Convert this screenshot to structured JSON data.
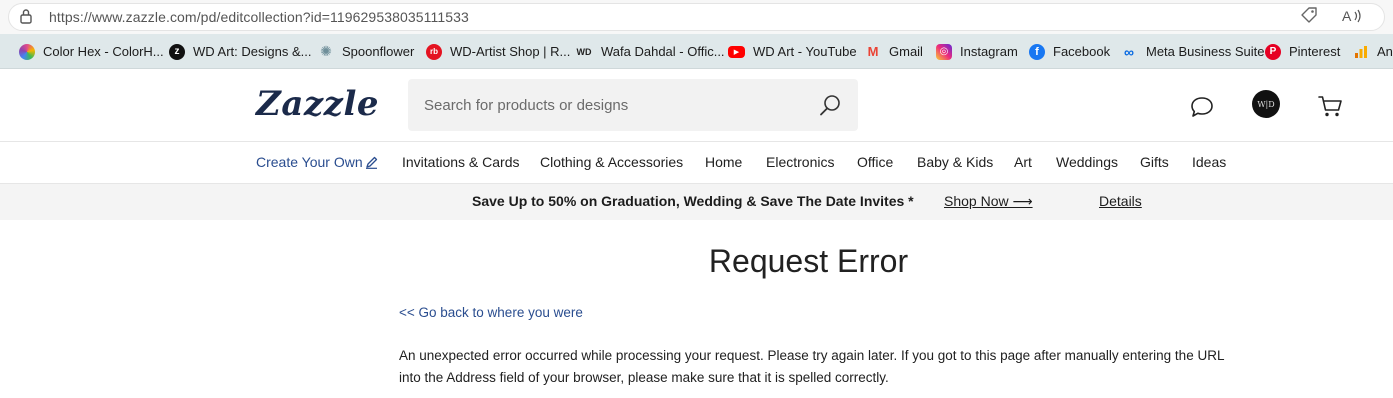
{
  "browser": {
    "url": "https://www.zazzle.com/pd/editcollection?id=119629538035111533",
    "bookmarks": [
      {
        "label": "Color Hex - ColorH...",
        "icon": "colorhex-icon",
        "color": "#e04a8b"
      },
      {
        "label": "WD Art: Designs &...",
        "icon": "zazzle-icon",
        "color": "#111111"
      },
      {
        "label": "Spoonflower",
        "icon": "spoonflower-icon",
        "color": "#6f8f9a"
      },
      {
        "label": "WD-Artist Shop | R...",
        "icon": "redbubble-icon",
        "color": "#e41321"
      },
      {
        "label": "Wafa Dahdal - Offic...",
        "icon": "wd-icon",
        "color": "#222222"
      },
      {
        "label": "WD Art - YouTube",
        "icon": "youtube-icon",
        "color": "#ff0000"
      },
      {
        "label": "Gmail",
        "icon": "gmail-icon",
        "color": "#ea4335"
      },
      {
        "label": "Instagram",
        "icon": "instagram-icon",
        "color": "#c13584"
      },
      {
        "label": "Facebook",
        "icon": "facebook-icon",
        "color": "#1877f2"
      },
      {
        "label": "Meta Business Suite",
        "icon": "meta-icon",
        "color": "#0668e1"
      },
      {
        "label": "Pinterest",
        "icon": "pinterest-icon",
        "color": "#e60023"
      },
      {
        "label": "Ana",
        "icon": "analytics-icon",
        "color": "#f9ab00"
      }
    ]
  },
  "header": {
    "logo": "Zazzle",
    "search_placeholder": "Search for products or designs",
    "avatar_text": "W|D"
  },
  "nav": {
    "items": [
      "Create Your Own",
      "Invitations & Cards",
      "Clothing & Accessories",
      "Home",
      "Electronics",
      "Office",
      "Baby & Kids",
      "Art",
      "Weddings",
      "Gifts",
      "Ideas"
    ]
  },
  "promo": {
    "text": "Save Up to 50% on Graduation, Wedding & Save The Date Invites *",
    "shop_now": "Shop Now ⟶",
    "details": "Details"
  },
  "main": {
    "title": "Request Error",
    "back_link": "<< Go back to where you were",
    "message": "An unexpected error occurred while processing your request. Please try again later. If you got to this page after manually entering the URL into the Address field of your browser, please make sure that it is spelled correctly."
  },
  "colors": {
    "brand_navy": "#1b2a4a",
    "link_blue": "#2a4d8f",
    "bookmark_bar": "#dfe8ea"
  }
}
